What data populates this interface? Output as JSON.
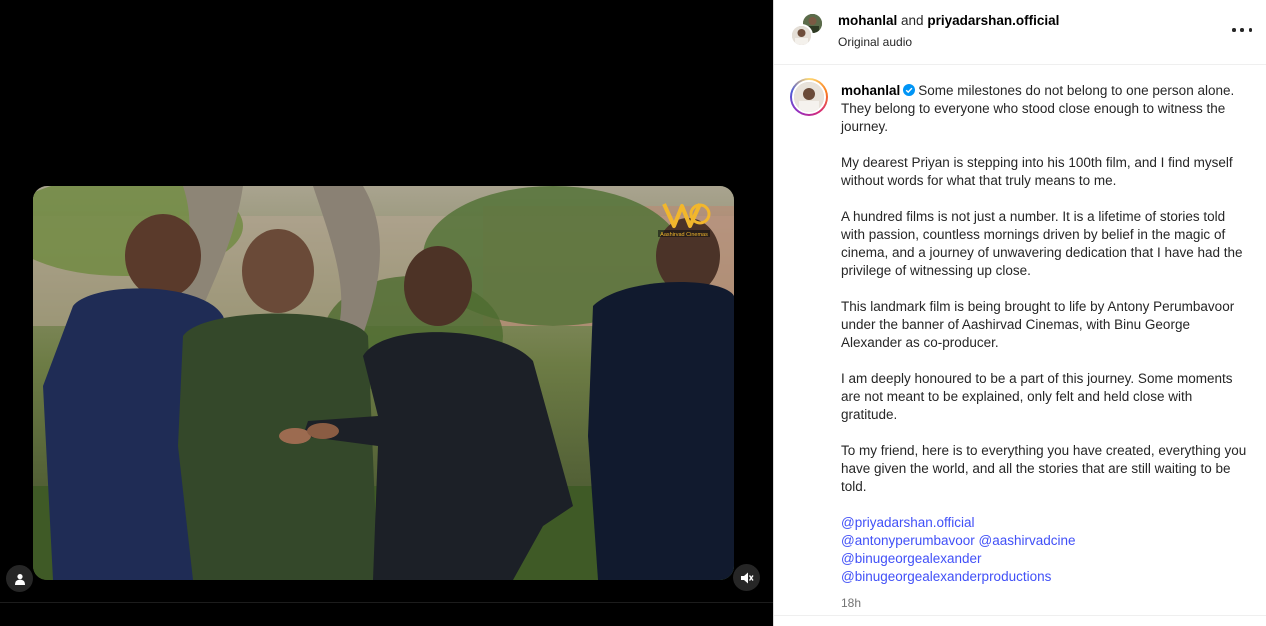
{
  "header": {
    "author_primary": "mohanlal",
    "connector": "and",
    "author_secondary": "priyadarshan.official",
    "audio": "Original audio"
  },
  "caption": {
    "username": "mohanlal",
    "first_line": "Some milestones do not belong to one person alone. They belong to everyone who stood close enough to witness the journey.",
    "paragraphs": [
      "My dearest Priyan is stepping into his 100th film, and I find myself without words for what that truly means to me.",
      "A hundred films is not just a number. It is a lifetime of stories told with passion, countless mornings driven by belief in the magic of cinema, and a journey of unwavering dedication that I have had the privilege of witnessing up close.",
      "This landmark film is being brought to life by Antony Perumbavoor under the banner of Aashirvad Cinemas, with Binu George Alexander as co-producer.",
      "I am deeply honoured to be a part of this journey. Some moments are not meant to be explained, only felt and held close with gratitude.",
      "To my friend, here is to everything you have created, everything you have given the world, and all the stories that are still waiting to be told."
    ],
    "mentions": [
      "@priyadarshan.official",
      "@antonyperumbavoor @aashirvadcine",
      "@binugeorgealexander",
      "@binugeorgealexanderproductions"
    ],
    "timestamp": "18h"
  },
  "media": {
    "watermark_text": "Aashirvad Cinemas",
    "tag_icon": "person-icon",
    "mute_icon": "speaker-muted-icon"
  },
  "colors": {
    "link": "#4150f7",
    "verified": "#0095f6",
    "muted_text": "#737373"
  }
}
